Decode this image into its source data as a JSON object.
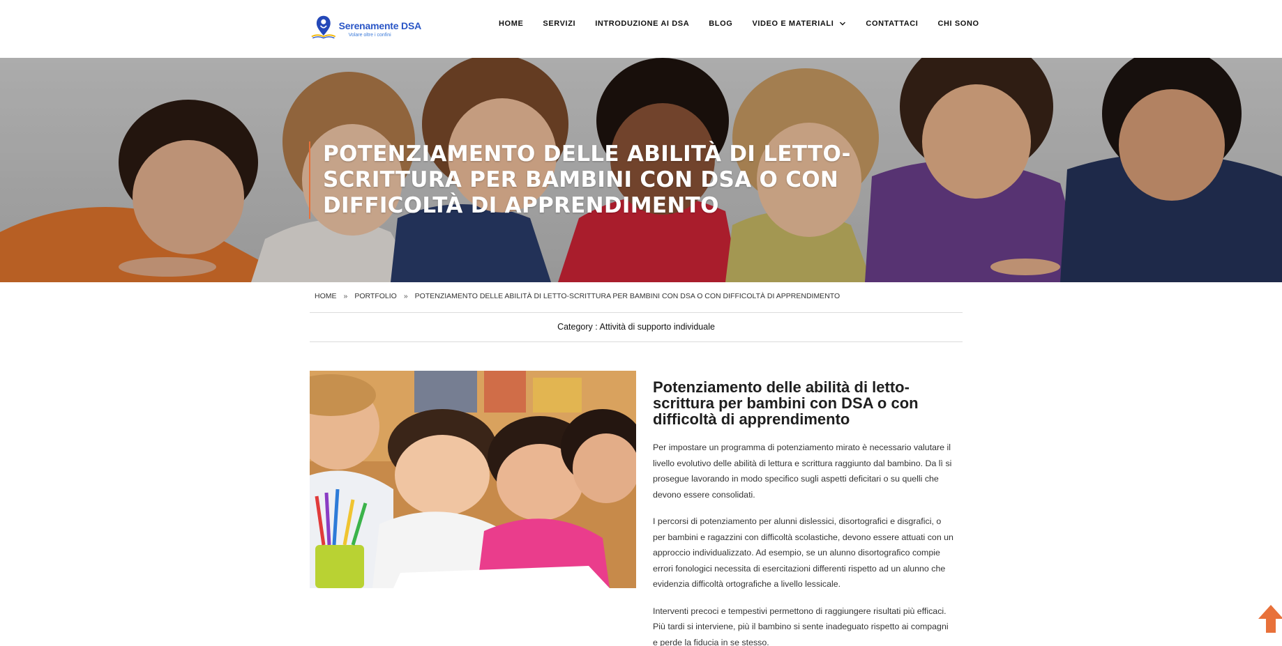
{
  "brand": {
    "name": "Serenamente DSA",
    "tagline": "Volare oltre i confini",
    "accent_color": "#e8713a",
    "brand_blue": "#2a56c6"
  },
  "nav": {
    "items": [
      {
        "label": "HOME"
      },
      {
        "label": "SERVIZI"
      },
      {
        "label": "INTRODUZIONE AI DSA"
      },
      {
        "label": "BLOG"
      },
      {
        "label": "VIDEO E MATERIALI",
        "has_dropdown": true
      },
      {
        "label": "CONTATTACI"
      },
      {
        "label": "CHI SONO"
      }
    ]
  },
  "hero": {
    "title": "POTENZIAMENTO DELLE ABILITÀ DI LETTO-SCRITTURA PER BAMBINI CON DSA O CON DIFFICOLTÀ DI APPRENDIMENTO"
  },
  "breadcrumb": {
    "items": [
      "HOME",
      "PORTFOLIO",
      "POTENZIAMENTO DELLE ABILITÀ DI LETTO-SCRITTURA PER BAMBINI CON DSA O CON DIFFICOLTÀ DI APPRENDIMENTO"
    ],
    "separator": "»"
  },
  "category": {
    "label": "Category :",
    "value": "Attività di supporto individuale"
  },
  "article": {
    "title": "Potenziamento delle abilità di letto-scrittura per bambini con DSA o con difficoltà di apprendimento",
    "paragraphs": [
      "Per impostare un programma di potenziamento mirato è necessario valutare il livello evolutivo delle abilità di lettura e scrittura raggiunto dal bambino. Da lì si prosegue lavorando in modo specifico sugli aspetti deficitari o su quelli che devono essere consolidati.",
      "I percorsi di potenziamento per alunni dislessici, disortografici e disgrafici, o per bambini e ragazzini con difficoltà scolastiche, devono essere attuati con un approccio individualizzato. Ad esempio, se un alunno disortografico compie errori fonologici necessita di esercitazioni differenti rispetto ad un alunno che evidenzia difficoltà ortografiche a livello lessicale.",
      "Interventi precoci e tempestivi permettono di raggiungere risultati più efficaci. Più tardi si interviene, più il bambino si sente inadeguato rispetto ai compagni e perde la fiducia in se stesso."
    ]
  },
  "icons": {
    "dropdown": "chevron-down-icon",
    "scroll_top": "arrow-up-icon",
    "logo": "location-pin-book-icon"
  }
}
